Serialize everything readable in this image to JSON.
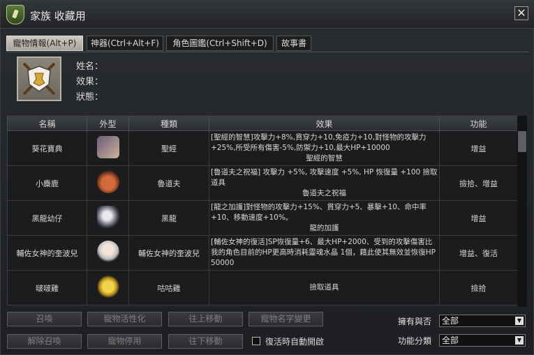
{
  "window": {
    "title": "家族 收藏用",
    "close_glyph": "✕"
  },
  "tabs": [
    {
      "label": "寵物情報(Alt+P)"
    },
    {
      "label": "神器(Ctrl+Alt+F)"
    },
    {
      "label": "角色圖鑑(Ctrl+Shift+D)"
    },
    {
      "label": "故事書"
    }
  ],
  "info": {
    "name_label": "姓名：",
    "effect_label": "效果：",
    "status_label": "狀態："
  },
  "table": {
    "headers": [
      "名稱",
      "外型",
      "種類",
      "效果",
      "功能"
    ],
    "rows": [
      {
        "name": "葵花寶典",
        "icon": "scroll-book-icon",
        "type": "聖經",
        "effect": "[聖經的智慧]攻擊力+8%,貫穿力+10,免疫力+10,對怪物的攻擊力+25%,所受所有傷害-5%,防禦力+10,最大HP+10000",
        "effect_name": "聖經的智慧",
        "function": "增益"
      },
      {
        "name": "小麋鹿",
        "icon": "deer-icon",
        "type": "魯道夫",
        "effect": "[魯道夫之祝福] 攻擊力 +5%, 攻擊速度 +5%, HP 恢復量 +100 撿取道具",
        "effect_name": "魯道夫之祝福",
        "function": "撿拾、增益"
      },
      {
        "name": "黑龍幼仔",
        "icon": "black-dragon-icon",
        "type": "黑龍",
        "effect": "[龍之加護]對怪物的攻擊力+15%、貫穿力+5、暴擊+10、命中率+10、移動速度+10%。",
        "effect_name": "龍的加護",
        "function": "增益"
      },
      {
        "name": "輔佐女神的奎波兒",
        "icon": "goddess-icon",
        "type": "輔佐女神的奎波兒",
        "effect": "[輔佐女神的復活]SP恢復量+6、最大HP+2000、受到的攻擊傷害比我的角色目前的HP更高時消耗靈魂水晶 1個，藉此使其無效並恢復HP 50000",
        "effect_name": "",
        "function": "增益、復活"
      },
      {
        "name": "啵啵雞",
        "icon": "chick-icon",
        "type": "咕咕雞",
        "effect": "",
        "effect_name": "撿取道具",
        "function": "撿拾"
      }
    ]
  },
  "buttons": {
    "summon": "召喚",
    "activate": "寵物活性化",
    "move_up": "往上移動",
    "rename": "寵物名字變更",
    "unsummon": "解除召喚",
    "stop": "寵物停用",
    "move_down": "往下移動"
  },
  "auto_enable": {
    "label": "復活時自動開啟",
    "checked": false
  },
  "filters": {
    "owned_label": "擁有與否",
    "owned_value": "全部",
    "category_label": "功能分類",
    "category_value": "全部"
  },
  "colors": {
    "active_tab": "#c8c3b8",
    "header_bg": "#34373a"
  }
}
